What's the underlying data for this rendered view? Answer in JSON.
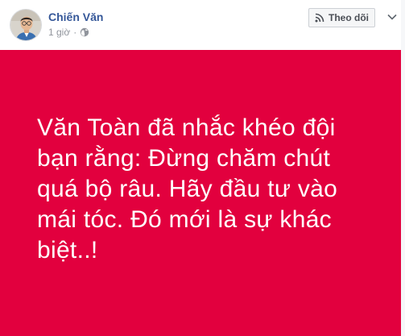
{
  "post": {
    "author_name": "Chiến Văn",
    "timestamp": "1 giờ",
    "separator": "·",
    "privacy_icon": "globe-icon",
    "follow_label": "Theo dõi",
    "follow_icon": "rss-icon",
    "menu_icon": "chevron-down-icon"
  },
  "content": {
    "background_color": "#e2003e",
    "text_color": "#ffffff",
    "text": "Văn Toàn đã nhắc khéo đội bạn rằng: Đừng chăm chút quá bộ râu. Hãy đầu tư vào mái tóc. Đó mới là sự khác biệt..!"
  },
  "colors": {
    "link": "#365899",
    "meta": "#90949c",
    "button_bg": "#f5f6f7"
  }
}
